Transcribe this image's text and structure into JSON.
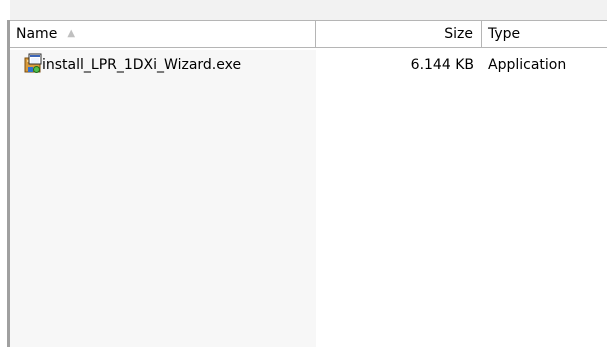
{
  "columns": {
    "name_label": "Name",
    "size_label": "Size",
    "type_label": "Type",
    "sort_icon": "sort-ascending-icon"
  },
  "files": [
    {
      "icon": "installer-exe-icon",
      "name": "install_LPR_1DXi_Wizard.exe",
      "size": "6.144 KB",
      "type": "Application"
    }
  ],
  "colors": {
    "background": "#ffffff",
    "header_border": "#b5b5b5",
    "sort_column_shade": "#f7f7f7",
    "sort_arrow": "#c0c0c0"
  }
}
